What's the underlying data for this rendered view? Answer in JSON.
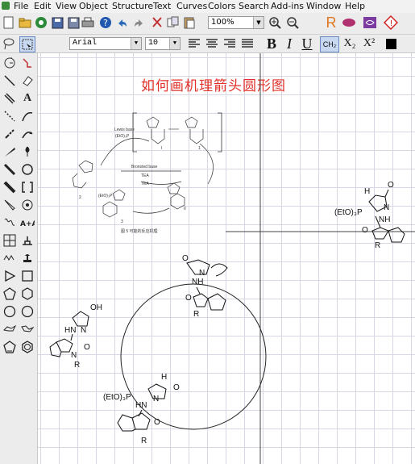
{
  "menu": [
    "File",
    "Edit",
    "View",
    "Object",
    "Structure",
    "Text",
    "Curves",
    "Colors",
    "Search",
    "Add-ins",
    "Window",
    "Help"
  ],
  "toolbar": {
    "zoom_value": "100%",
    "font_name": "Arial",
    "font_size": "10",
    "bold": "B",
    "italic": "I",
    "underline": "U",
    "subscript": "X₂",
    "superscript": "X²",
    "chem_label": "CH₂",
    "r_label": "R"
  },
  "palette": {
    "text_tool": "A"
  },
  "canvas": {
    "title": "如何画机理箭头圆形图",
    "embedded_figure": {
      "caption": "图 5 可能的反应机理",
      "lewis_base_label": "Lewis base",
      "reagent_1": "(EtO)₃P",
      "bronsted_base_label": "Bronsted base",
      "tea_1": "TEA",
      "tea_2": "TEA",
      "num_I": "I",
      "num_II": "II",
      "num_1": "1",
      "num_2": "2",
      "num_3": "3",
      "reagent_2": "(EtO)₃P"
    },
    "product_right": {
      "reagent": "(EtO)₃P",
      "h": "H",
      "o": "O",
      "n": "N",
      "nh": "NH",
      "r": "R"
    },
    "zwitterion_top": {
      "o": "O",
      "n": "N",
      "nh": "NH",
      "r": "R"
    },
    "pyrazolone_left": {
      "oh": "OH",
      "hn": "HN",
      "n": "N",
      "o": "O",
      "r": "R"
    },
    "adduct_bottom": {
      "reagent": "(EtO)₃P",
      "h": "H",
      "o": "O",
      "n": "N",
      "hn": "HN",
      "r": "R"
    }
  }
}
